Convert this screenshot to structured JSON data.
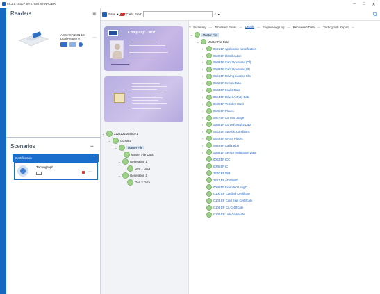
{
  "window": {
    "title": "v4.3.0.1930 - SYSTEM MANAGER",
    "minimize": "–",
    "maximize": "□",
    "close": "✕"
  },
  "readers": {
    "title": "Readers",
    "device": {
      "name": "ACS ACR1581 1S Dual Reader 0",
      "more": "···"
    }
  },
  "scenarios": {
    "title": "Scenarios",
    "group": "Certification",
    "item": "Tachograph",
    "more": "···"
  },
  "toolbar": {
    "save": "Save",
    "clear": "Clear",
    "find": "Find:",
    "find_value": "",
    "search_icon": "⌕"
  },
  "card": {
    "title": "Company Card"
  },
  "tabs": [
    "Summary",
    "Tabulated Errors",
    "Details",
    "Engineering Log",
    "Recovered Data",
    "Tachograph Report"
  ],
  "active_tab": "Details",
  "left_tree": {
    "card_id": "22222221644/071",
    "contact": "Contact",
    "master_file": "Master File",
    "master_file_data": "Master File Data",
    "gen1": "Generation 1",
    "gen1_data": "Gen 1 Data",
    "gen2": "Generation 2",
    "gen2_data": "Gen 2 Data"
  },
  "right_tree": {
    "root": "Master File",
    "child": "Master File Data",
    "items": [
      "0501 EF Application Identification",
      "0520 EF Identification",
      "0508 EF Card Download (Of)",
      "0509 EF Card Download (R)",
      "0521 EF Driving Licence Info",
      "0502 EF Events Data",
      "0503 EF Faults Data",
      "0504 EF Driver Activity Data",
      "0505 EF Vehicles Used",
      "0506 EF Places",
      "0507 EF Current Usage",
      "0508 EF Control Activity Data",
      "0522 EF Specific Conditions",
      "0524 EF GNSS Places",
      "0504 EF Calibration",
      "0508 EF Sensor Installation Data",
      "0002 EF ICC",
      "0005 EF IC",
      "2F00 EF DIR",
      "2F01 EF ATR/INFO",
      "0006 EF Extended Length",
      "C100 EF Cardlink Certificate",
      "C101 EF Card Sign Certificate",
      "C108 EF CA Certificate",
      "C109 EF Link Certificate"
    ]
  },
  "colors": {
    "accent": "#1a6fcd",
    "status_ok": "#9ed189",
    "lock": "#d8372f"
  }
}
